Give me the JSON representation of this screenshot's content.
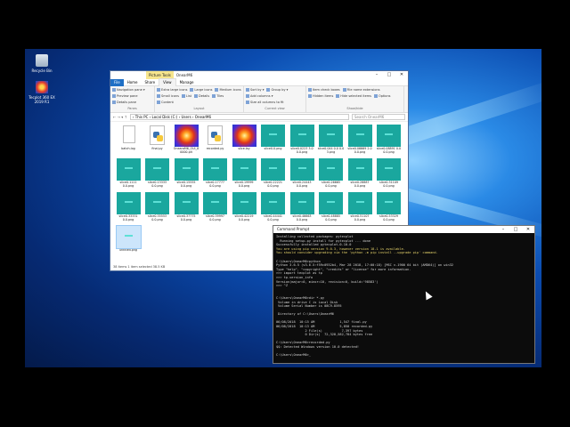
{
  "desktop": {
    "icons": [
      {
        "label": "Recycle Bin",
        "icon": "recycle-bin-icon"
      },
      {
        "label": "Tecplot 360 EX 2019 R1",
        "icon": "tecplot-icon"
      }
    ]
  },
  "explorer": {
    "context_tab": "Picture Tools",
    "title": "OnearM6",
    "window_buttons": [
      "–",
      "□",
      "✕"
    ],
    "tabs": [
      "File",
      "Home",
      "Share",
      "View",
      "Manage"
    ],
    "ribbon": {
      "groups": [
        {
          "label": "Panes",
          "items": [
            "Navigation pane ▾",
            "Preview pane",
            "Details pane"
          ]
        },
        {
          "label": "Layout",
          "items": [
            "Extra large icons",
            "Large icons",
            "Medium icons",
            "Small icons",
            "List",
            "Details",
            "Tiles",
            "Content"
          ]
        },
        {
          "label": "Current view",
          "items": [
            "Sort by ▾",
            "Group by ▾",
            "Add columns ▾",
            "Size all columns to fit"
          ]
        },
        {
          "label": "Show/hide",
          "items": [
            "Item check boxes",
            "File name extensions",
            "Hidden items",
            "Hide selected items",
            "Options"
          ]
        }
      ]
    },
    "address": {
      "nav": "← → ▾ ↑",
      "path": "› This PC › Local Disk (C:) › Users › OnearM6",
      "search_placeholder": "Search OnearM6"
    },
    "files": [
      {
        "name": "batch.log",
        "kind": "txt"
      },
      {
        "name": "final.py",
        "kind": "py"
      },
      {
        "name": "OnearaM6_OUI_8 0000.plt",
        "kind": "fire"
      },
      {
        "name": "recorded.py",
        "kind": "py"
      },
      {
        "name": "slice.lay",
        "kind": "fire"
      },
      {
        "name": "slice0.0.png",
        "kind": "heat"
      },
      {
        "name": "slice0.0223 3.0 0.0.png",
        "kind": "heat"
      },
      {
        "name": "slice0.044 0.0 0.0 3.png",
        "kind": "heat"
      },
      {
        "name": "slice0.06669 2.0 0.0.png",
        "kind": "heat"
      },
      {
        "name": "slice0.08891 0.0 0.0.png",
        "kind": "heat"
      },
      {
        "name": "slice0.1111 0.0.png",
        "kind": "heat"
      },
      {
        "name": "slice0.13333 0.0.png",
        "kind": "heat"
      },
      {
        "name": "slice0.15555 0.0.png",
        "kind": "heat"
      },
      {
        "name": "slice0.17777 0.0.png",
        "kind": "heat"
      },
      {
        "name": "slice0.19999 0.0.png",
        "kind": "heat"
      },
      {
        "name": "slice0.22221 0.0.png",
        "kind": "heat"
      },
      {
        "name": "slice0.24443 0.0.png",
        "kind": "heat"
      },
      {
        "name": "slice0.26665 0.0.png",
        "kind": "heat"
      },
      {
        "name": "slice0.28887 0.0.png",
        "kind": "heat"
      },
      {
        "name": "slice0.31109 0.0.png",
        "kind": "heat"
      },
      {
        "name": "slice0.33331 0.0.png",
        "kind": "heat"
      },
      {
        "name": "slice0.35553 0.0.png",
        "kind": "heat"
      },
      {
        "name": "slice0.37775 0.0.png",
        "kind": "heat"
      },
      {
        "name": "slice0.39997 0.0.png",
        "kind": "heat"
      },
      {
        "name": "slice0.42219 0.0.png",
        "kind": "heat"
      },
      {
        "name": "slice0.44441 0.0.png",
        "kind": "heat"
      },
      {
        "name": "slice0.46663 0.0.png",
        "kind": "heat"
      },
      {
        "name": "slice0.48885 0.0.png",
        "kind": "heat"
      },
      {
        "name": "slice0.51107 0.0.png",
        "kind": "heat"
      },
      {
        "name": "slice0.53329 0.0.png",
        "kind": "heat"
      },
      {
        "name": "untitled.png",
        "kind": "heat"
      }
    ],
    "status": "38 items   1 item selected  38.5 KB"
  },
  "cmd": {
    "title": "Command Prompt",
    "lines": [
      {
        "text": "Installing collected packages: pytecplot",
        "warn": false
      },
      {
        "text": "  Running setup.py install for pytecplot ... done",
        "warn": false
      },
      {
        "text": "Successfully installed pytecplot-0.10.0",
        "warn": false
      },
      {
        "text": "You are using pip version 9.0.3, however version 18.1 is available.",
        "warn": true
      },
      {
        "text": "You should consider upgrading via the 'python -m pip install --upgrade pip' command.",
        "warn": true
      },
      {
        "text": "",
        "warn": false
      },
      {
        "text": "C:\\Users\\OnearM6>python",
        "warn": false
      },
      {
        "text": "Python 3.6.5 (v3.6.5:f59c0932b4, Mar 28 2018, 17:00:18) [MSC v.1900 64 bit (AMD64)] on win32",
        "warn": false
      },
      {
        "text": "Type \"help\", \"copyright\", \"credits\" or \"license\" for more information.",
        "warn": false
      },
      {
        "text": ">>> import tecplot as tp",
        "warn": false
      },
      {
        "text": ">>> tp.version_info",
        "warn": false
      },
      {
        "text": "Version(major=0, minor=10, revision=0, build='98583')",
        "warn": false
      },
      {
        "text": ">>> ^Z",
        "warn": false
      },
      {
        "text": "",
        "warn": false
      },
      {
        "text": "",
        "warn": false
      },
      {
        "text": "C:\\Users\\OnearM6>dir *.py",
        "warn": false
      },
      {
        "text": " Volume in drive C is Local Disk",
        "warn": false
      },
      {
        "text": " Volume Serial Number is 08C9-8595",
        "warn": false
      },
      {
        "text": "",
        "warn": false
      },
      {
        "text": " Directory of C:\\Users\\OnearM6",
        "warn": false
      },
      {
        "text": "",
        "warn": false
      },
      {
        "text": "06/08/2018  10:15 AM             1,547 final.py",
        "warn": false
      },
      {
        "text": "06/08/2018  10:13 AM             5,850 recorded.py",
        "warn": false
      },
      {
        "text": "               2 File(s)          7,397 bytes",
        "warn": false
      },
      {
        "text": "               0 Dir(s)  72,328,582,784 bytes free",
        "warn": false
      },
      {
        "text": "",
        "warn": false
      },
      {
        "text": "C:\\Users\\OnearM6>recorded.py",
        "warn": false
      },
      {
        "text": "$$: Detected Windows version 10.0 detected!",
        "warn": false
      },
      {
        "text": "",
        "warn": false
      },
      {
        "text": "C:\\Users\\OnearM6>_",
        "warn": false
      }
    ]
  }
}
